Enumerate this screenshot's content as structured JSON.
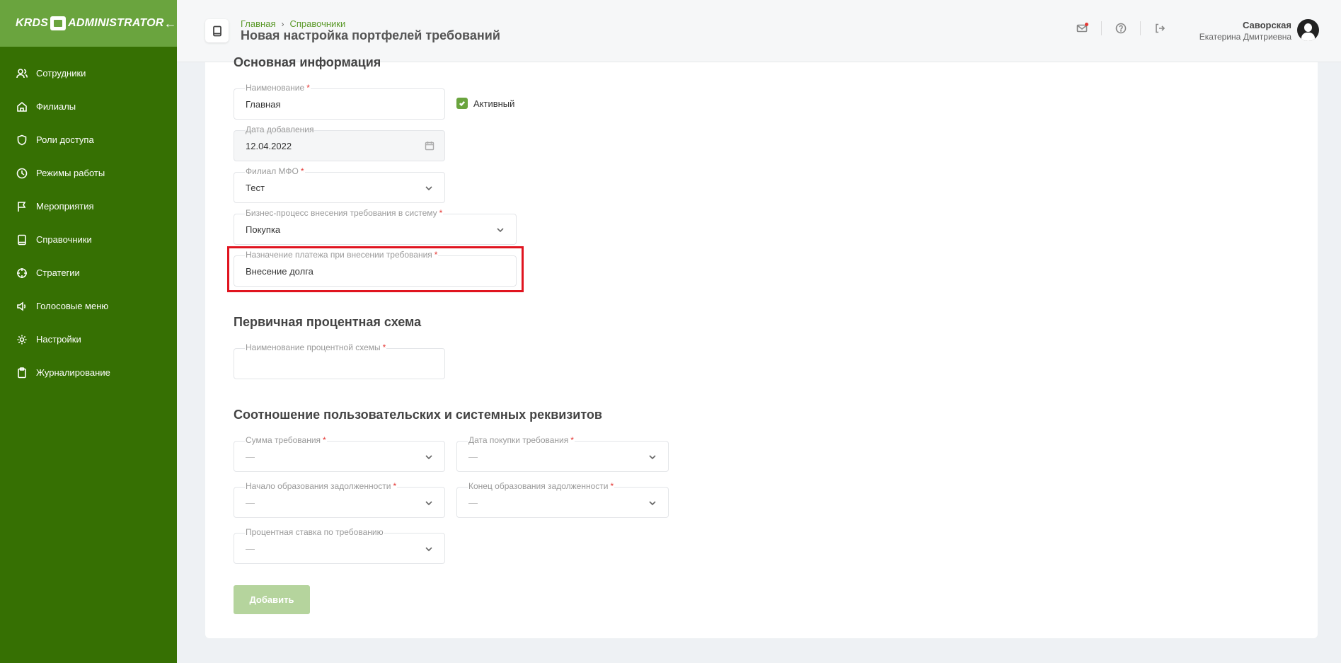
{
  "sidebar": {
    "logo_left": "KRDS",
    "logo_right": "ADMINISTRATOR",
    "collapse_icon": "arrow-left-icon",
    "items": [
      {
        "label": "Сотрудники",
        "icon": "users-icon"
      },
      {
        "label": "Филиалы",
        "icon": "home-icon"
      },
      {
        "label": "Роли доступа",
        "icon": "shield-icon"
      },
      {
        "label": "Режимы работы",
        "icon": "clock-icon"
      },
      {
        "label": "Мероприятия",
        "icon": "flag-icon"
      },
      {
        "label": "Справочники",
        "icon": "book-icon"
      },
      {
        "label": "Стратегии",
        "icon": "crosshair-icon"
      },
      {
        "label": "Голосовые меню",
        "icon": "speaker-icon"
      },
      {
        "label": "Настройки",
        "icon": "gear-icon"
      },
      {
        "label": "Журналирование",
        "icon": "clipboard-icon"
      }
    ],
    "colors": {
      "background": "#367003",
      "header": "#6aa43e"
    }
  },
  "header": {
    "breadcrumb": [
      "Главная",
      "Справочники"
    ],
    "title": "Новая настройка портфелей требований",
    "icons": [
      "mail-icon",
      "help-icon",
      "logout-icon"
    ],
    "user": {
      "last_name": "Саворская",
      "first_name": "Екатерина Дмитриевна"
    }
  },
  "form": {
    "section_main": "Основная информация",
    "name": {
      "label": "Наименование",
      "value": "Главная",
      "required": true
    },
    "active": {
      "label": "Активный",
      "checked": true
    },
    "date_added": {
      "label": "Дата добавления",
      "value": "12.04.2022"
    },
    "branch": {
      "label": "Филиал МФО",
      "value": "Тест",
      "required": true
    },
    "business_process": {
      "label": "Бизнес-процесс внесения требования в систему",
      "value": "Покупка",
      "required": true
    },
    "payment_purpose": {
      "label": "Назначение платежа при внесении требования",
      "value": "Внесение долга",
      "required": true
    },
    "section_interest": "Первичная процентная схема",
    "interest_scheme": {
      "label": "Наименование процентной схемы",
      "value": "",
      "required": true
    },
    "section_mapping": "Соотношение пользовательских и системных реквизитов",
    "claim_amount": {
      "label": "Сумма требования",
      "value": "—",
      "required": true
    },
    "purchase_date": {
      "label": "Дата покупки требования",
      "value": "—",
      "required": true
    },
    "debt_start": {
      "label": "Начало образования задолженности",
      "value": "—",
      "required": true
    },
    "debt_end": {
      "label": "Конец образования задолженности",
      "value": "—",
      "required": true
    },
    "interest_rate": {
      "label": "Процентная ставка по требованию",
      "value": "—",
      "required": false
    },
    "submit_label": "Добавить"
  },
  "accent_color": "#6aa43e",
  "highlight_color": "#e0141f"
}
